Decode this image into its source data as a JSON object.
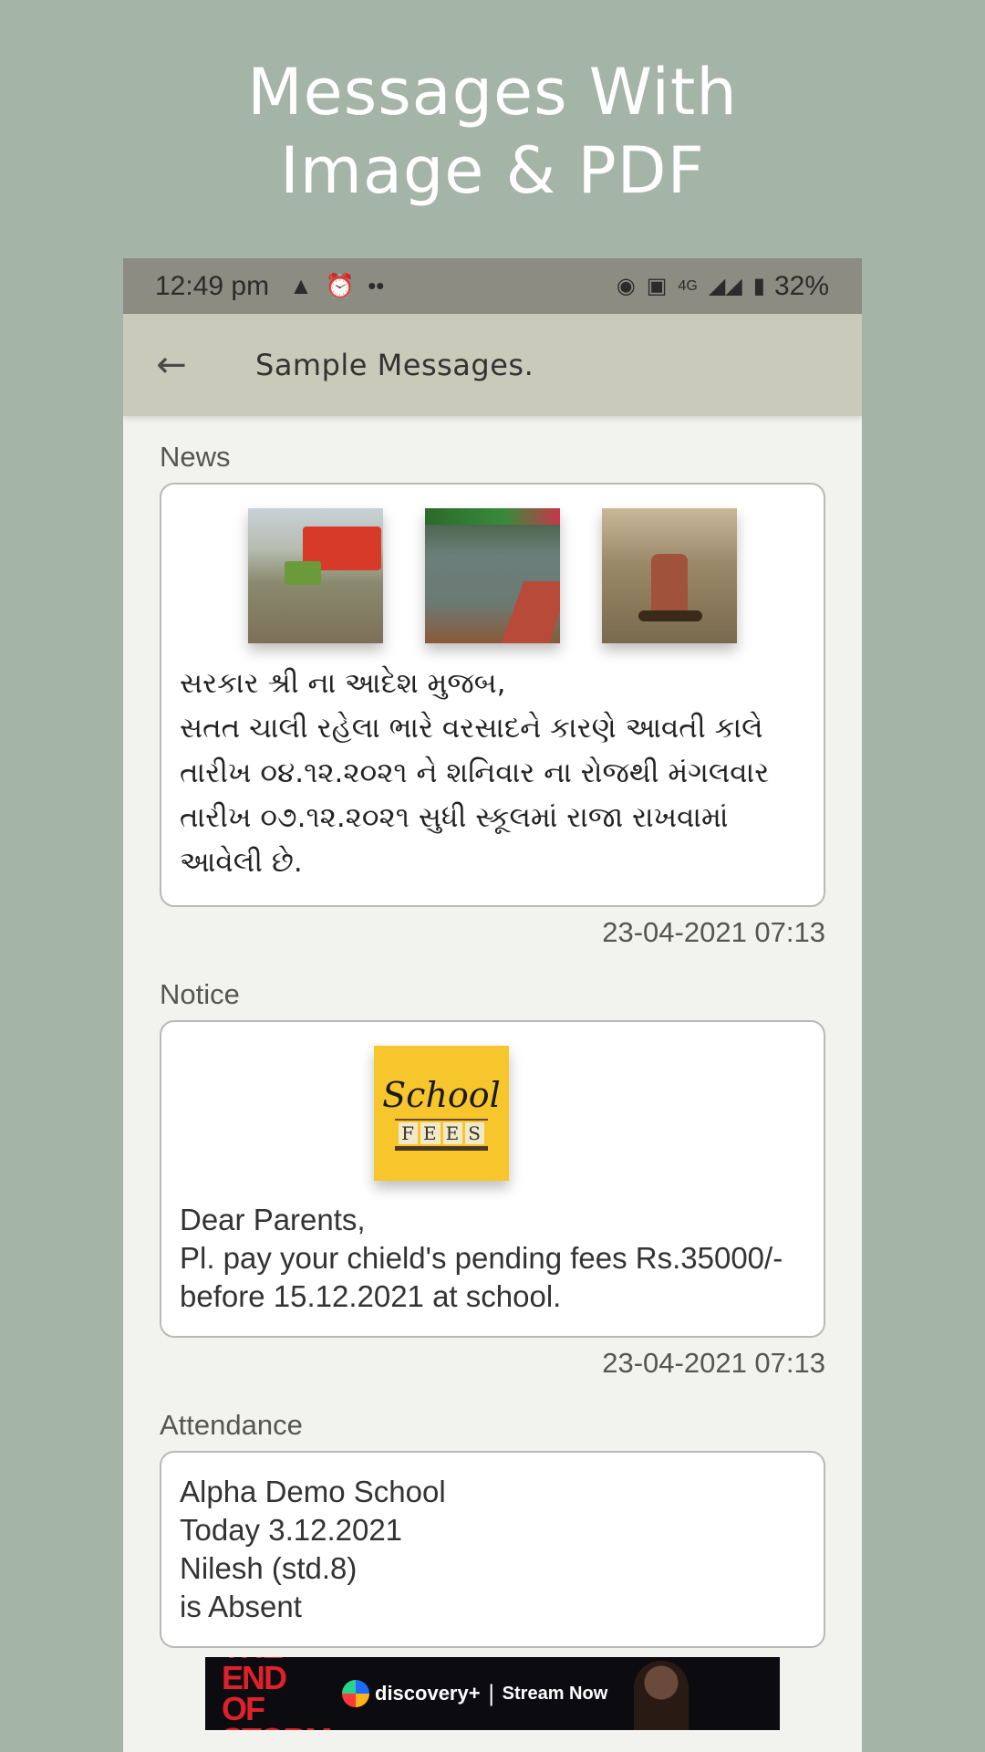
{
  "promo": {
    "title_line1": "Messages With",
    "title_line2": "Image & PDF"
  },
  "statusbar": {
    "time": "12:49 pm",
    "network": "4G",
    "battery": "32%",
    "icons": [
      "warning-icon",
      "alarm-icon",
      "more-dots-icon",
      "hotspot-icon",
      "volte-icon",
      "signal-icon",
      "battery-icon"
    ]
  },
  "appbar": {
    "title": "Sample Messages.",
    "back_icon": "arrow-back-icon"
  },
  "messages": [
    {
      "category": "News",
      "text": "સરકાર શ્રી ના આદેશ મુજબ,\nસતત ચાલી રહેલા ભારે વરસાદને કારણે આવતી કાલે\nતારીખ ૦૪.૧૨.૨૦૨૧ ને શનિવાર ના રોજથી મંગલવાર\nતારીખ ૦૭.૧૨.૨૦૨૧ સુધી સ્કૂલમાં રાજા રાખવામાં\nઆવેલી છે.",
      "timestamp": "23-04-2021 07:13",
      "images": [
        "flood-street-image",
        "flood-underpass-image",
        "flood-boat-image"
      ]
    },
    {
      "category": "Notice",
      "text": "Dear Parents,\nPl. pay your chield's pending fees Rs.35000/-\nbefore 15.12.2021 at school.",
      "timestamp": "23-04-2021 07:13",
      "image": {
        "school": "School",
        "fees": [
          "F",
          "E",
          "E",
          "S"
        ]
      }
    },
    {
      "category": "Attendance",
      "text": "Alpha Demo School\nToday 3.12.2021\nNilesh (std.8)\nis Absent"
    }
  ],
  "ad": {
    "headline": "THE END OF STORM",
    "brand": "discovery+",
    "cta": "Stream Now"
  },
  "colors": {
    "background": "#a4b4a6",
    "appbar": "#cacabb",
    "statusbar": "#8c8c82"
  }
}
